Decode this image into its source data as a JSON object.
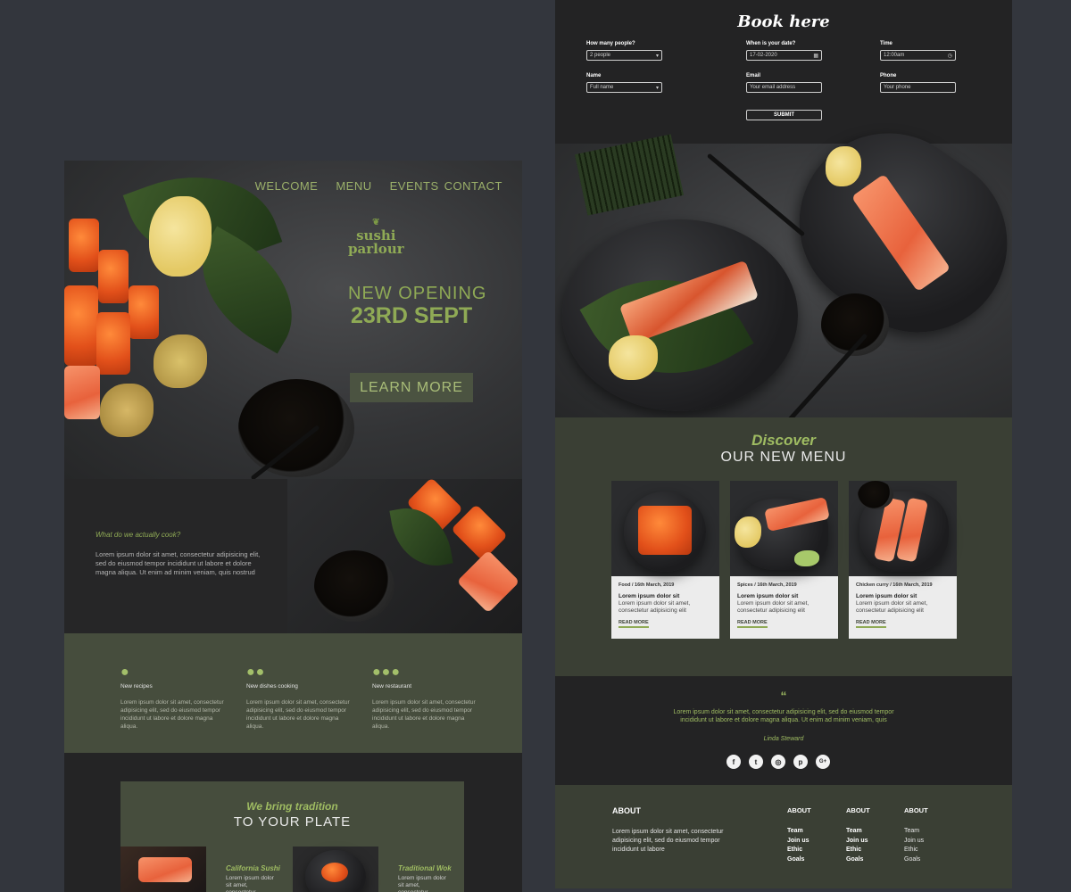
{
  "left": {
    "nav": [
      "WELCOME",
      "MENU",
      "EVENTS",
      "CONTACT"
    ],
    "logo": {
      "line1": "sushi",
      "line2": "parlour"
    },
    "hero": {
      "line1": "NEW OPENING",
      "line2": "23RD SEPT",
      "cta": "LEARN MORE"
    },
    "about": {
      "label": "What do we actually cook?",
      "text": "Lorem ipsum dolor sit amet, consectetur adipisicing elit, sed do eiusmod tempor incididunt ut labore et dolore magna aliqua. Ut enim ad minim veniam, quis nostrud"
    },
    "features": [
      {
        "dots": "●",
        "title": "New recipes",
        "desc": "Lorem ipsum dolor sit amet, consectetur adipisicing elit, sed do eiusmod tempor incididunt ut labore et dolore magna aliqua."
      },
      {
        "dots": "●●",
        "title": "New dishes cooking",
        "desc": "Lorem ipsum dolor sit amet, consectetur adipisicing elit, sed do eiusmod tempor incididunt ut labore et dolore magna aliqua."
      },
      {
        "dots": "●●●",
        "title": "New restaurant",
        "desc": "Lorem ipsum dolor sit amet, consectetur adipisicing elit, sed do eiusmod tempor incididunt ut labore et dolore magna aliqua."
      }
    ],
    "tradition": {
      "line1": "We bring tradition",
      "line2": "TO YOUR PLATE",
      "dishes": [
        {
          "title": "California Sushi",
          "desc": "Lorem ipsum dolor sit amet, consectetur"
        },
        {
          "title": "Traditional Wok",
          "desc": "Lorem ipsum dolor sit amet, consectetur"
        }
      ]
    }
  },
  "right": {
    "booking": {
      "title": "Book here",
      "people": {
        "label": "How many people?",
        "value": "2 people"
      },
      "date": {
        "label": "When is your date?",
        "value": "17-02-2020"
      },
      "time": {
        "label": "Time",
        "value": "12:00am"
      },
      "name": {
        "label": "Name",
        "placeholder": "Full name"
      },
      "email": {
        "label": "Email",
        "placeholder": "Your email address"
      },
      "phone": {
        "label": "Phone",
        "placeholder": "Your phone"
      },
      "submit": "SUBMIT"
    },
    "discover": {
      "line1": "Discover",
      "line2": "OUR NEW MENU",
      "cards": [
        {
          "meta": "Food / 16th March, 2019",
          "title": "Lorem ipsum dolor sit",
          "desc": "Lorem ipsum dolor sit amet, consectetur adipisicing elit",
          "link": "READ MORE"
        },
        {
          "meta": "Spices / 16th March, 2019",
          "title": "Lorem ipsum dolor sit",
          "desc": "Lorem ipsum dolor sit amet, consectetur adipisicing elit",
          "link": "READ MORE"
        },
        {
          "meta": "Chicken curry / 16th March, 2019",
          "title": "Lorem ipsum dolor sit",
          "desc": "Lorem ipsum dolor sit amet, consectetur adipisicing elit",
          "link": "READ MORE"
        }
      ]
    },
    "testimonial": {
      "mark": "“",
      "text": "Lorem ipsum dolor sit amet, consectetur adipisicing elit, sed do eiusmod tempor incididunt ut labore et dolore magna aliqua. Ut enim ad minim veniam, quis",
      "name": "Linda Steward"
    },
    "socials": [
      "f",
      "t",
      "◎",
      "p",
      "G+"
    ],
    "footer": {
      "about_title": "ABOUT",
      "about_text": "Lorem ipsum dolor sit amet, consectetur adipisicing elit, sed do eiusmod tempor incididunt ut labore",
      "cols": [
        {
          "title": "ABOUT",
          "items": [
            "Team",
            "Join us",
            "Ethic",
            "Goals"
          ]
        },
        {
          "title": "ABOUT",
          "items": [
            "Team",
            "Join us",
            "Ethic",
            "Goals"
          ]
        },
        {
          "title": "ABOUT",
          "items": [
            "Team",
            "Join us",
            "Ethic",
            "Goals"
          ]
        }
      ]
    }
  }
}
